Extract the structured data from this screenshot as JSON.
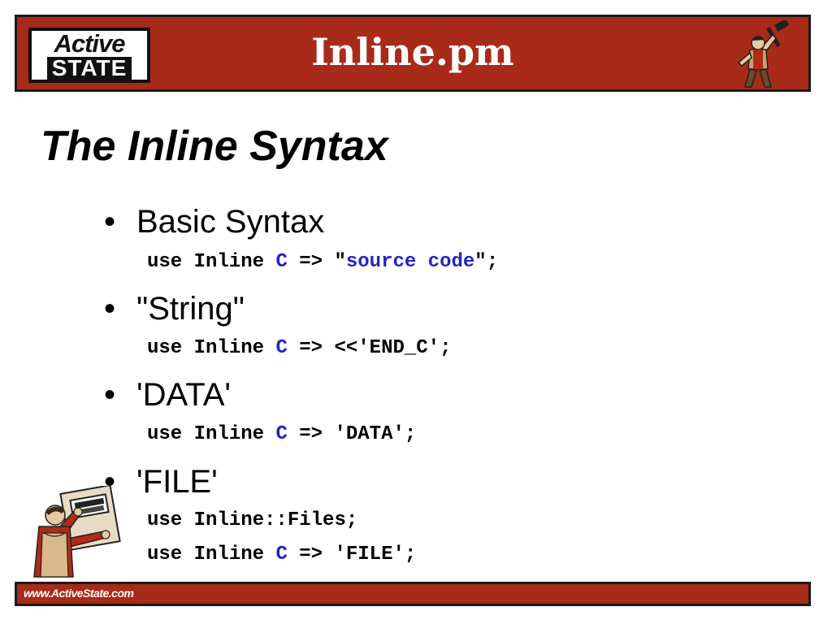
{
  "header": {
    "logo_top": "Active",
    "logo_bottom": "STATE",
    "title": "Inline.pm"
  },
  "slide": {
    "title": "The Inline Syntax",
    "bullets": [
      {
        "label": "Basic Syntax",
        "code": [
          {
            "pre": "use Inline ",
            "lang": "C",
            "mid": " => \"",
            "src": "source code",
            "post": "\";"
          }
        ]
      },
      {
        "label": "\"String\"",
        "code": [
          {
            "pre": "use Inline ",
            "lang": "C",
            "post": " => <<'END_C';"
          }
        ]
      },
      {
        "label": "'DATA'",
        "code": [
          {
            "pre": "use Inline ",
            "lang": "C",
            "post": " => 'DATA';"
          }
        ]
      },
      {
        "label": "'FILE'",
        "code": [
          {
            "pre": "use Inline::Files;"
          },
          {
            "pre": "use Inline ",
            "lang": "C",
            "post": " => 'FILE';"
          }
        ]
      }
    ]
  },
  "footer": {
    "url": "www.ActiveState.com"
  },
  "colors": {
    "brand_red": "#a82a18",
    "code_blue": "#2424c8"
  },
  "icons": [
    "activestate-logo",
    "worker-hammer-icon",
    "worker-holding-sign-mascot"
  ]
}
